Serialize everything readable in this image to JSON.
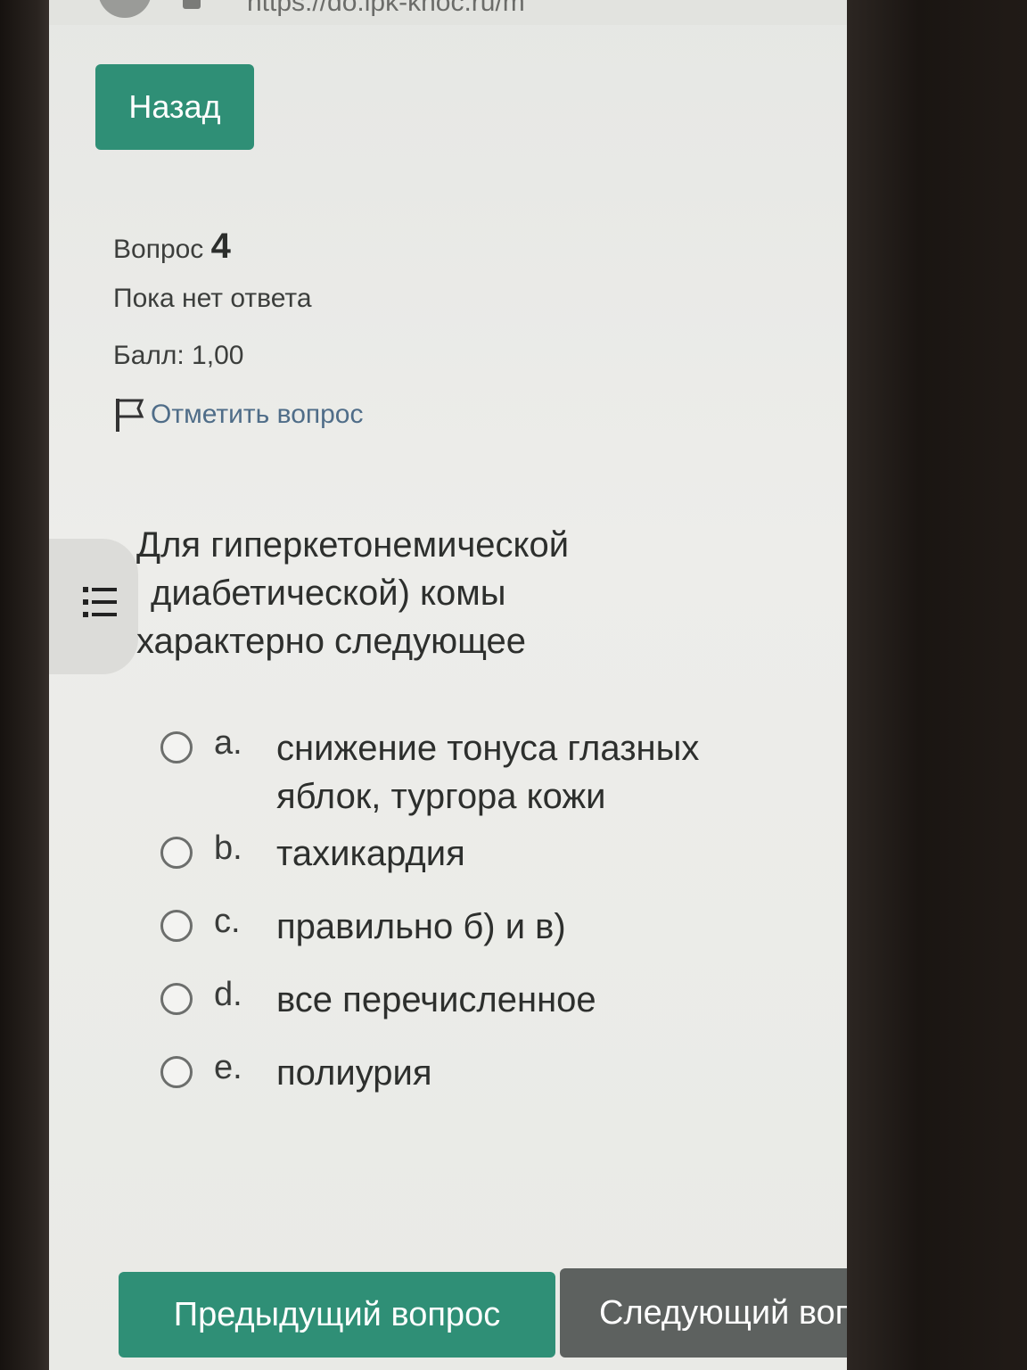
{
  "browser": {
    "url": "https://do.ipk-knoc.ru/m"
  },
  "nav": {
    "back_label": "Назад"
  },
  "question_info": {
    "label": "Вопрос",
    "number": "4",
    "status": "Пока нет ответа",
    "score": "Балл: 1,00",
    "flag_label": "Отметить вопрос"
  },
  "question": {
    "lines": [
      "Для гиперкетонемической",
      "диабетической) комы",
      "характерно следующее"
    ]
  },
  "answers": [
    {
      "letter": "a.",
      "text": "снижение тонуса глазных яблок, тургора кожи"
    },
    {
      "letter": "b.",
      "text": "тахикардия"
    },
    {
      "letter": "c.",
      "text": "правильно б) и в)"
    },
    {
      "letter": "d.",
      "text": "все перечисленное"
    },
    {
      "letter": "e.",
      "text": "полиурия"
    }
  ],
  "footer": {
    "prev_label": "Предыдущий вопрос",
    "next_label": "Следующий вопрос"
  },
  "colors": {
    "primary": "#2f8f76",
    "secondary": "#5d615f",
    "link": "#4f6d88"
  }
}
